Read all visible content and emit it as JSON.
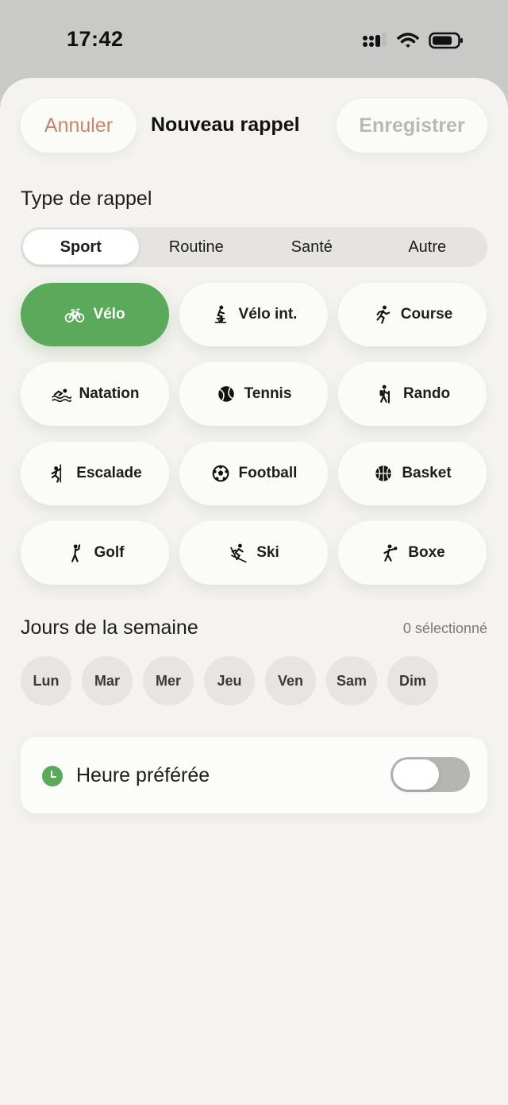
{
  "status_bar": {
    "time": "17:42"
  },
  "header": {
    "cancel_label": "Annuler",
    "title": "Nouveau rappel",
    "save_label": "Enregistrer"
  },
  "type_section": {
    "label": "Type de rappel",
    "segments": [
      "Sport",
      "Routine",
      "Santé",
      "Autre"
    ],
    "selected_segment": "Sport"
  },
  "activities": [
    {
      "label": "Vélo",
      "icon": "bike-icon",
      "selected": true
    },
    {
      "label": "Vélo int.",
      "icon": "indoor-cycle-icon",
      "selected": false
    },
    {
      "label": "Course",
      "icon": "run-icon",
      "selected": false
    },
    {
      "label": "Natation",
      "icon": "swim-icon",
      "selected": false
    },
    {
      "label": "Tennis",
      "icon": "tennis-ball-icon",
      "selected": false
    },
    {
      "label": "Rando",
      "icon": "hiking-icon",
      "selected": false
    },
    {
      "label": "Escalade",
      "icon": "climbing-icon",
      "selected": false
    },
    {
      "label": "Football",
      "icon": "soccer-ball-icon",
      "selected": false
    },
    {
      "label": "Basket",
      "icon": "basketball-icon",
      "selected": false
    },
    {
      "label": "Golf",
      "icon": "golf-icon",
      "selected": false
    },
    {
      "label": "Ski",
      "icon": "ski-icon",
      "selected": false
    },
    {
      "label": "Boxe",
      "icon": "boxing-icon",
      "selected": false
    }
  ],
  "days_section": {
    "label": "Jours de la semaine",
    "count_label": "0 sélectionné",
    "days": [
      "Lun",
      "Mar",
      "Mer",
      "Jeu",
      "Ven",
      "Sam",
      "Dim"
    ]
  },
  "preferred_time": {
    "label": "Heure préférée",
    "enabled": false
  },
  "colors": {
    "accent_green": "#5ba95a",
    "cancel_text": "#c8866a",
    "sheet_bg": "#f4f3ef"
  }
}
